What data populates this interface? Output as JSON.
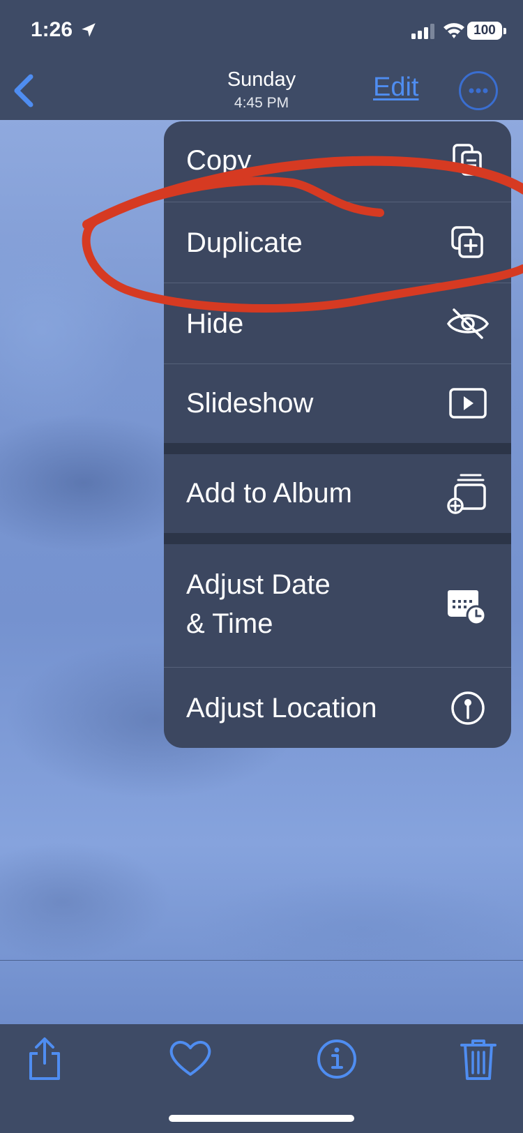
{
  "status_bar": {
    "time": "1:26",
    "battery": "100"
  },
  "nav": {
    "title": "Sunday",
    "subtitle": "4:45 PM",
    "edit_label": "Edit"
  },
  "menu": {
    "items": [
      {
        "label": "Copy",
        "icon": "copy-icon"
      },
      {
        "label": "Duplicate",
        "icon": "duplicate-icon"
      },
      {
        "label": "Hide",
        "icon": "eye-slash-icon"
      },
      {
        "label": "Slideshow",
        "icon": "play-rectangle-icon"
      },
      {
        "label": "Add to Album",
        "icon": "add-to-album-icon"
      },
      {
        "label_line1": "Adjust Date",
        "label_line2": "& Time",
        "icon": "calendar-clock-icon"
      },
      {
        "label": "Adjust Location",
        "icon": "location-pin-icon"
      }
    ]
  },
  "toolbar": {
    "icons": [
      "share-icon",
      "heart-icon",
      "info-icon",
      "trash-icon"
    ]
  },
  "colors": {
    "accent": "#4f8df1",
    "annotation": "#d63a22",
    "menu_bg": "#3c4760",
    "bar_bg": "#3e4b66"
  }
}
